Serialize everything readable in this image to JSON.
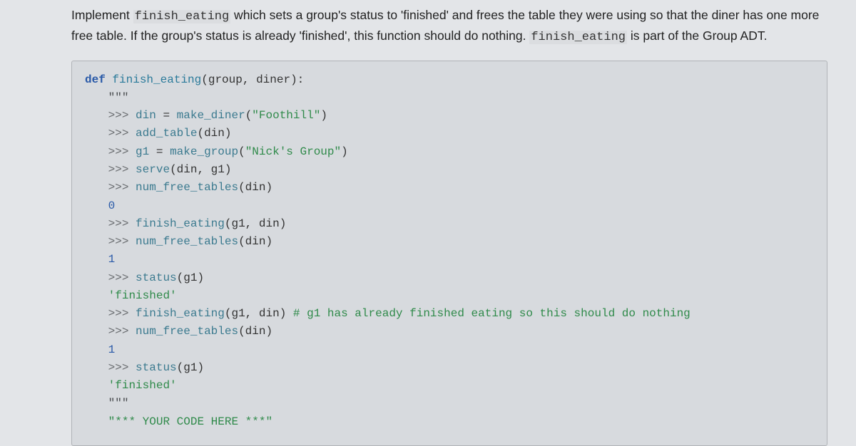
{
  "problem": {
    "pre": "Implement ",
    "fn": "finish_eating",
    "mid1": " which sets a group's status to 'finished' and frees the table they were using so that the diner has one more free table. If the group's status is already 'finished', this function should do nothing. ",
    "fn2": "finish_eating",
    "mid2": " is part of the Group ADT."
  },
  "code": {
    "sig_def": "def",
    "sig_name": "finish_eating",
    "sig_params": "(group, diner):",
    "docq": "\"\"\"",
    "lines": [
      {
        "prompt": ">>> ",
        "tokens": [
          {
            "t": "din",
            "c": "ident"
          },
          {
            "t": " = ",
            "c": "punct"
          },
          {
            "t": "make_diner",
            "c": "call"
          },
          {
            "t": "(",
            "c": "punct"
          },
          {
            "t": "\"Foothill\"",
            "c": "string"
          },
          {
            "t": ")",
            "c": "punct"
          }
        ]
      },
      {
        "prompt": ">>> ",
        "tokens": [
          {
            "t": "add_table",
            "c": "call"
          },
          {
            "t": "(din)",
            "c": "punct"
          }
        ]
      },
      {
        "prompt": ">>> ",
        "tokens": [
          {
            "t": "g1",
            "c": "ident"
          },
          {
            "t": " = ",
            "c": "punct"
          },
          {
            "t": "make_group",
            "c": "call"
          },
          {
            "t": "(",
            "c": "punct"
          },
          {
            "t": "\"Nick's Group\"",
            "c": "string"
          },
          {
            "t": ")",
            "c": "punct"
          }
        ]
      },
      {
        "prompt": ">>> ",
        "tokens": [
          {
            "t": "serve",
            "c": "call"
          },
          {
            "t": "(din, g1)",
            "c": "punct"
          }
        ]
      },
      {
        "prompt": ">>> ",
        "tokens": [
          {
            "t": "num_free_tables",
            "c": "call"
          },
          {
            "t": "(din)",
            "c": "punct"
          }
        ]
      },
      {
        "prompt": "",
        "tokens": [
          {
            "t": "0",
            "c": "num"
          }
        ]
      },
      {
        "prompt": ">>> ",
        "tokens": [
          {
            "t": "finish_eating",
            "c": "call"
          },
          {
            "t": "(g1, din)",
            "c": "punct"
          }
        ]
      },
      {
        "prompt": ">>> ",
        "tokens": [
          {
            "t": "num_free_tables",
            "c": "call"
          },
          {
            "t": "(din)",
            "c": "punct"
          }
        ]
      },
      {
        "prompt": "",
        "tokens": [
          {
            "t": "1",
            "c": "num"
          }
        ]
      },
      {
        "prompt": ">>> ",
        "tokens": [
          {
            "t": "status",
            "c": "call"
          },
          {
            "t": "(g1)",
            "c": "punct"
          }
        ]
      },
      {
        "prompt": "",
        "tokens": [
          {
            "t": "'finished'",
            "c": "string"
          }
        ]
      },
      {
        "prompt": ">>> ",
        "tokens": [
          {
            "t": "finish_eating",
            "c": "call"
          },
          {
            "t": "(g1, din) ",
            "c": "punct"
          },
          {
            "t": "# g1 has already finished eating so this should do nothing",
            "c": "comment"
          }
        ]
      },
      {
        "prompt": ">>> ",
        "tokens": [
          {
            "t": "num_free_tables",
            "c": "call"
          },
          {
            "t": "(din)",
            "c": "punct"
          }
        ]
      },
      {
        "prompt": "",
        "tokens": [
          {
            "t": "1",
            "c": "num"
          }
        ]
      },
      {
        "prompt": ">>> ",
        "tokens": [
          {
            "t": "status",
            "c": "call"
          },
          {
            "t": "(g1)",
            "c": "punct"
          }
        ]
      },
      {
        "prompt": "",
        "tokens": [
          {
            "t": "'finished'",
            "c": "string"
          }
        ]
      }
    ],
    "docq_close": "\"\"\"",
    "placeholder": "\"*** YOUR CODE HERE ***\""
  }
}
